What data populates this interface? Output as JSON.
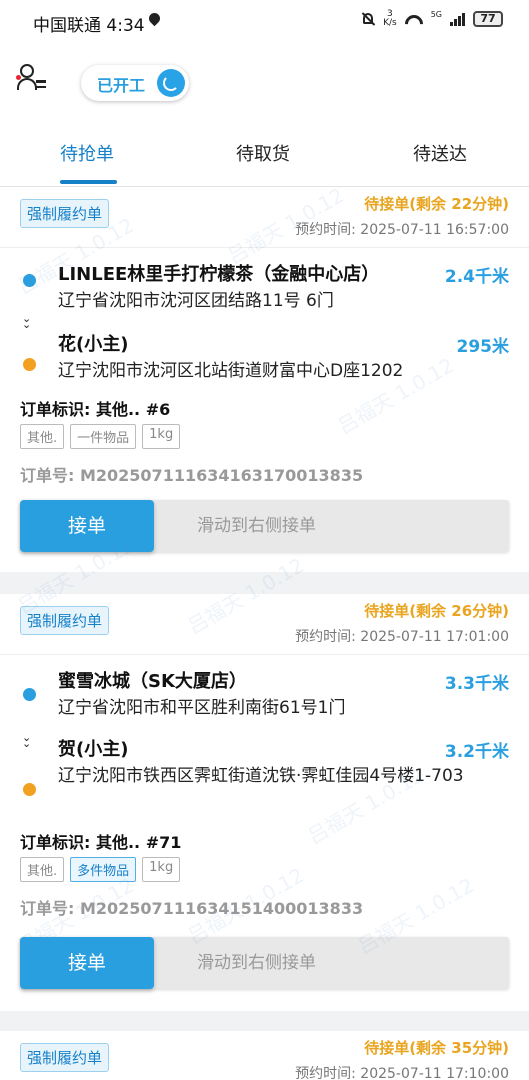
{
  "status_bar": {
    "carrier": "中国联通",
    "time": "4:34",
    "speed_value": "3",
    "speed_unit": "K/s",
    "network": "5G",
    "battery": "77"
  },
  "header": {
    "work_status_label": "已开工"
  },
  "tabs": [
    {
      "label": "待抢单",
      "active": true
    },
    {
      "label": "待取货",
      "active": false
    },
    {
      "label": "待送达",
      "active": false
    }
  ],
  "watermark": "吕福天 1.0.12",
  "colors": {
    "accent": "#2a9fe0",
    "status_orange": "#e9a520",
    "pickup_dot": "#2a9fe0",
    "dropoff_dot": "#f2a020"
  },
  "orders": [
    {
      "badge": "强制履约单",
      "status": "待接单(剩余 22分钟)",
      "appointment": "预约时间: 2025-07-11 16:57:00",
      "pickup": {
        "name": "LINLEE林里手打柠檬茶（金融中心店）",
        "distance": "2.4千米",
        "address": "辽宁省沈阳市沈河区团结路11号 6门"
      },
      "dropoff": {
        "name": "花(小主)",
        "distance": "295米",
        "address": "辽宁沈阳市沈河区北站街道财富中心D座1202"
      },
      "tag": "订单标识: 其他.. #6",
      "chips": [
        {
          "label": "其他.",
          "highlight": false
        },
        {
          "label": "一件物品",
          "highlight": false
        },
        {
          "label": "1kg",
          "highlight": false
        }
      ],
      "order_no": "订单号: M20250711163416317001383​5",
      "accept_label": "接单",
      "slide_hint": "滑动到右侧接单"
    },
    {
      "badge": "强制履约单",
      "status": "待接单(剩余 26分钟)",
      "appointment": "预约时间: 2025-07-11 17:01:00",
      "pickup": {
        "name": "蜜雪冰城（SK大厦店）",
        "distance": "3.3千米",
        "address": "辽宁省沈阳市和平区胜利南街61号1门"
      },
      "dropoff": {
        "name": "贺(小主)",
        "distance": "3.2千米",
        "address": "辽宁沈阳市铁西区霁虹街道沈铁·霁虹佳园4号楼1-703"
      },
      "tag": "订单标识: 其他.. #71",
      "chips": [
        {
          "label": "其他.",
          "highlight": false
        },
        {
          "label": "多件物品",
          "highlight": true
        },
        {
          "label": "1kg",
          "highlight": false
        }
      ],
      "order_no": "订单号: M20250711163415140001383​3",
      "accept_label": "接单",
      "slide_hint": "滑动到右侧接单"
    },
    {
      "badge": "强制履约单",
      "status": "待接单(剩余 35分钟)",
      "appointment": "预约时间: 2025-07-11 17:10:00"
    }
  ]
}
